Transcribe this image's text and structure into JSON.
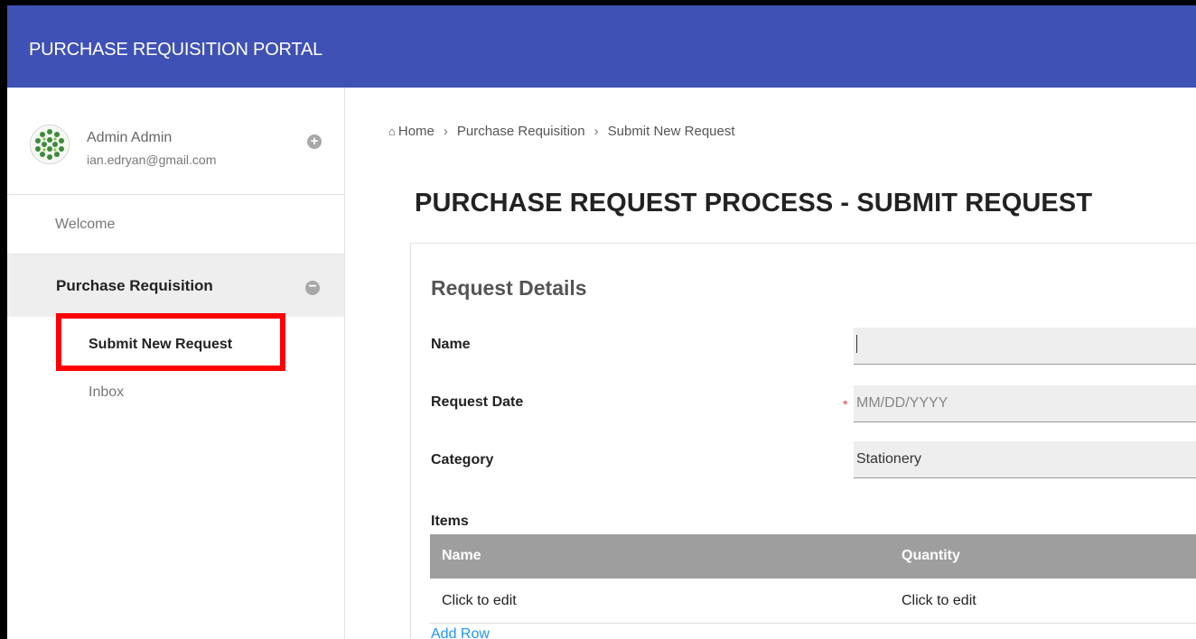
{
  "app": {
    "title": "PURCHASE REQUISITION PORTAL"
  },
  "user": {
    "name": "Admin Admin",
    "email": "ian.edryan@gmail.com"
  },
  "sidebar": {
    "welcome_label": "Welcome",
    "section_label": "Purchase Requisition",
    "items": [
      {
        "label": "Submit New Request"
      },
      {
        "label": "Inbox"
      }
    ]
  },
  "breadcrumb": {
    "home": "Home",
    "level1": "Purchase Requisition",
    "level2": "Submit New Request"
  },
  "page": {
    "title": "PURCHASE REQUEST PROCESS - SUBMIT REQUEST"
  },
  "form": {
    "section_title": "Request Details",
    "name_label": "Name",
    "name_value": "",
    "date_label": "Request Date",
    "date_placeholder": "MM/DD/YYYY",
    "category_label": "Category",
    "category_value": "Stationery",
    "items_label": "Items",
    "table": {
      "columns": [
        "Name",
        "Quantity"
      ],
      "rows": [
        [
          "Click to edit",
          "Click to edit"
        ]
      ]
    },
    "add_row_label": "Add Row"
  },
  "colors": {
    "header_bg": "#3f51b5",
    "highlight_border": "#ff0000",
    "table_header_bg": "#9e9e9e",
    "link": "#2196f3"
  }
}
